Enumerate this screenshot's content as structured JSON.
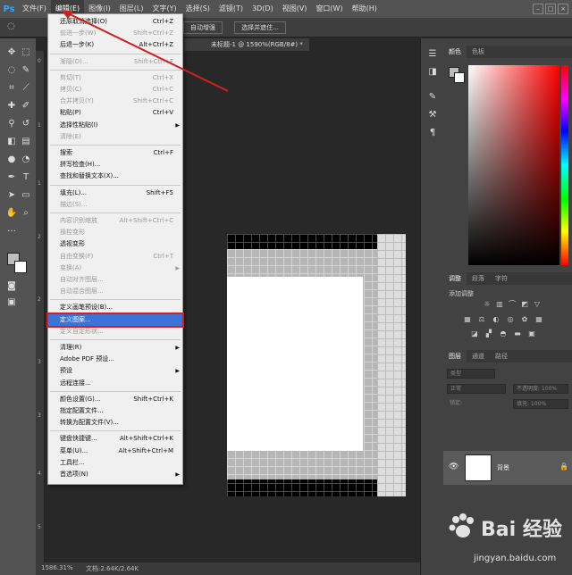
{
  "app": {
    "logo": "Ps"
  },
  "menubar": {
    "items": [
      "文件(F)",
      "编辑(E)",
      "图像(I)",
      "图层(L)",
      "文字(Y)",
      "选择(S)",
      "滤镜(T)",
      "3D(D)",
      "视图(V)",
      "窗口(W)",
      "帮助(H)"
    ],
    "active_index": 1
  },
  "optionsbar": {
    "select_subject": "自动增强",
    "select_and_mask": "选择并遮住..."
  },
  "document": {
    "tab_title": "未标题-1 @ 1590%(RGB/8#) *",
    "status_zoom": "1586.31%",
    "status_doc": "文档:2.64K/2.64K"
  },
  "edit_menu": {
    "items": [
      {
        "label": "还原取消选择(O)",
        "shortcut": "Ctrl+Z",
        "disabled": false
      },
      {
        "label": "前进一步(W)",
        "shortcut": "Shift+Ctrl+Z",
        "disabled": true
      },
      {
        "label": "后退一步(K)",
        "shortcut": "Alt+Ctrl+Z",
        "disabled": false
      },
      {
        "label": "渐隐(D)...",
        "shortcut": "Shift+Ctrl+F",
        "disabled": true
      },
      {
        "label": "剪切(T)",
        "shortcut": "Ctrl+X",
        "disabled": true
      },
      {
        "label": "拷贝(C)",
        "shortcut": "Ctrl+C",
        "disabled": true
      },
      {
        "label": "合并拷贝(Y)",
        "shortcut": "Shift+Ctrl+C",
        "disabled": true
      },
      {
        "label": "粘贴(P)",
        "shortcut": "Ctrl+V",
        "disabled": false
      },
      {
        "label": "选择性粘贴(I)",
        "shortcut": "",
        "disabled": false,
        "submenu": true
      },
      {
        "label": "清除(E)",
        "shortcut": "",
        "disabled": true
      },
      {
        "label": "搜索",
        "shortcut": "Ctrl+F",
        "disabled": false
      },
      {
        "label": "拼写检查(H)...",
        "shortcut": "",
        "disabled": false
      },
      {
        "label": "查找和替换文本(X)...",
        "shortcut": "",
        "disabled": false
      },
      {
        "label": "填充(L)...",
        "shortcut": "Shift+F5",
        "disabled": false
      },
      {
        "label": "描边(S)...",
        "shortcut": "",
        "disabled": true
      },
      {
        "label": "内容识别缩放",
        "shortcut": "Alt+Shift+Ctrl+C",
        "disabled": true
      },
      {
        "label": "操控变形",
        "shortcut": "",
        "disabled": true
      },
      {
        "label": "透视变形",
        "shortcut": "",
        "disabled": false
      },
      {
        "label": "自由变换(F)",
        "shortcut": "Ctrl+T",
        "disabled": true
      },
      {
        "label": "变换(A)",
        "shortcut": "",
        "disabled": true,
        "submenu": true
      },
      {
        "label": "自动对齐图层...",
        "shortcut": "",
        "disabled": true
      },
      {
        "label": "自动混合图层...",
        "shortcut": "",
        "disabled": true
      },
      {
        "label": "定义画笔预设(B)...",
        "shortcut": "",
        "disabled": false
      },
      {
        "label": "定义图案...",
        "shortcut": "",
        "disabled": false,
        "highlight": true
      },
      {
        "label": "定义自定形状...",
        "shortcut": "",
        "disabled": true
      },
      {
        "label": "清理(R)",
        "shortcut": "",
        "disabled": false,
        "submenu": true
      },
      {
        "label": "Adobe PDF 预设...",
        "shortcut": "",
        "disabled": false
      },
      {
        "label": "预设",
        "shortcut": "",
        "disabled": false,
        "submenu": true
      },
      {
        "label": "远程连接...",
        "shortcut": "",
        "disabled": false
      },
      {
        "label": "颜色设置(G)...",
        "shortcut": "Shift+Ctrl+K",
        "disabled": false
      },
      {
        "label": "指定配置文件...",
        "shortcut": "",
        "disabled": false
      },
      {
        "label": "转换为配置文件(V)...",
        "shortcut": "",
        "disabled": false
      },
      {
        "label": "键盘快捷键...",
        "shortcut": "Alt+Shift+Ctrl+K",
        "disabled": false
      },
      {
        "label": "菜单(U)...",
        "shortcut": "Alt+Shift+Ctrl+M",
        "disabled": false
      },
      {
        "label": "工具栏...",
        "shortcut": "",
        "disabled": false
      },
      {
        "label": "首选项(N)",
        "shortcut": "",
        "disabled": false,
        "submenu": true
      }
    ]
  },
  "panels": {
    "color_tabs": [
      "颜色",
      "色板"
    ],
    "adjust_tabs": [
      "调整",
      "段落",
      "字符"
    ],
    "add_adjustment": "添加调整",
    "layers_tabs": [
      "图层",
      "通道",
      "路径"
    ],
    "layer_filter": "类型",
    "blend_mode": "正常",
    "opacity_label": "不透明度: 100%",
    "lock_label": "锁定:",
    "fill_label": "填充: 100%",
    "layer_name": "背景"
  },
  "watermark": {
    "brand": "Bai 经验",
    "url": "jingyan.baidu.com"
  },
  "colors": {
    "highlight": "#3b74d6",
    "annotation": "#d02020"
  }
}
